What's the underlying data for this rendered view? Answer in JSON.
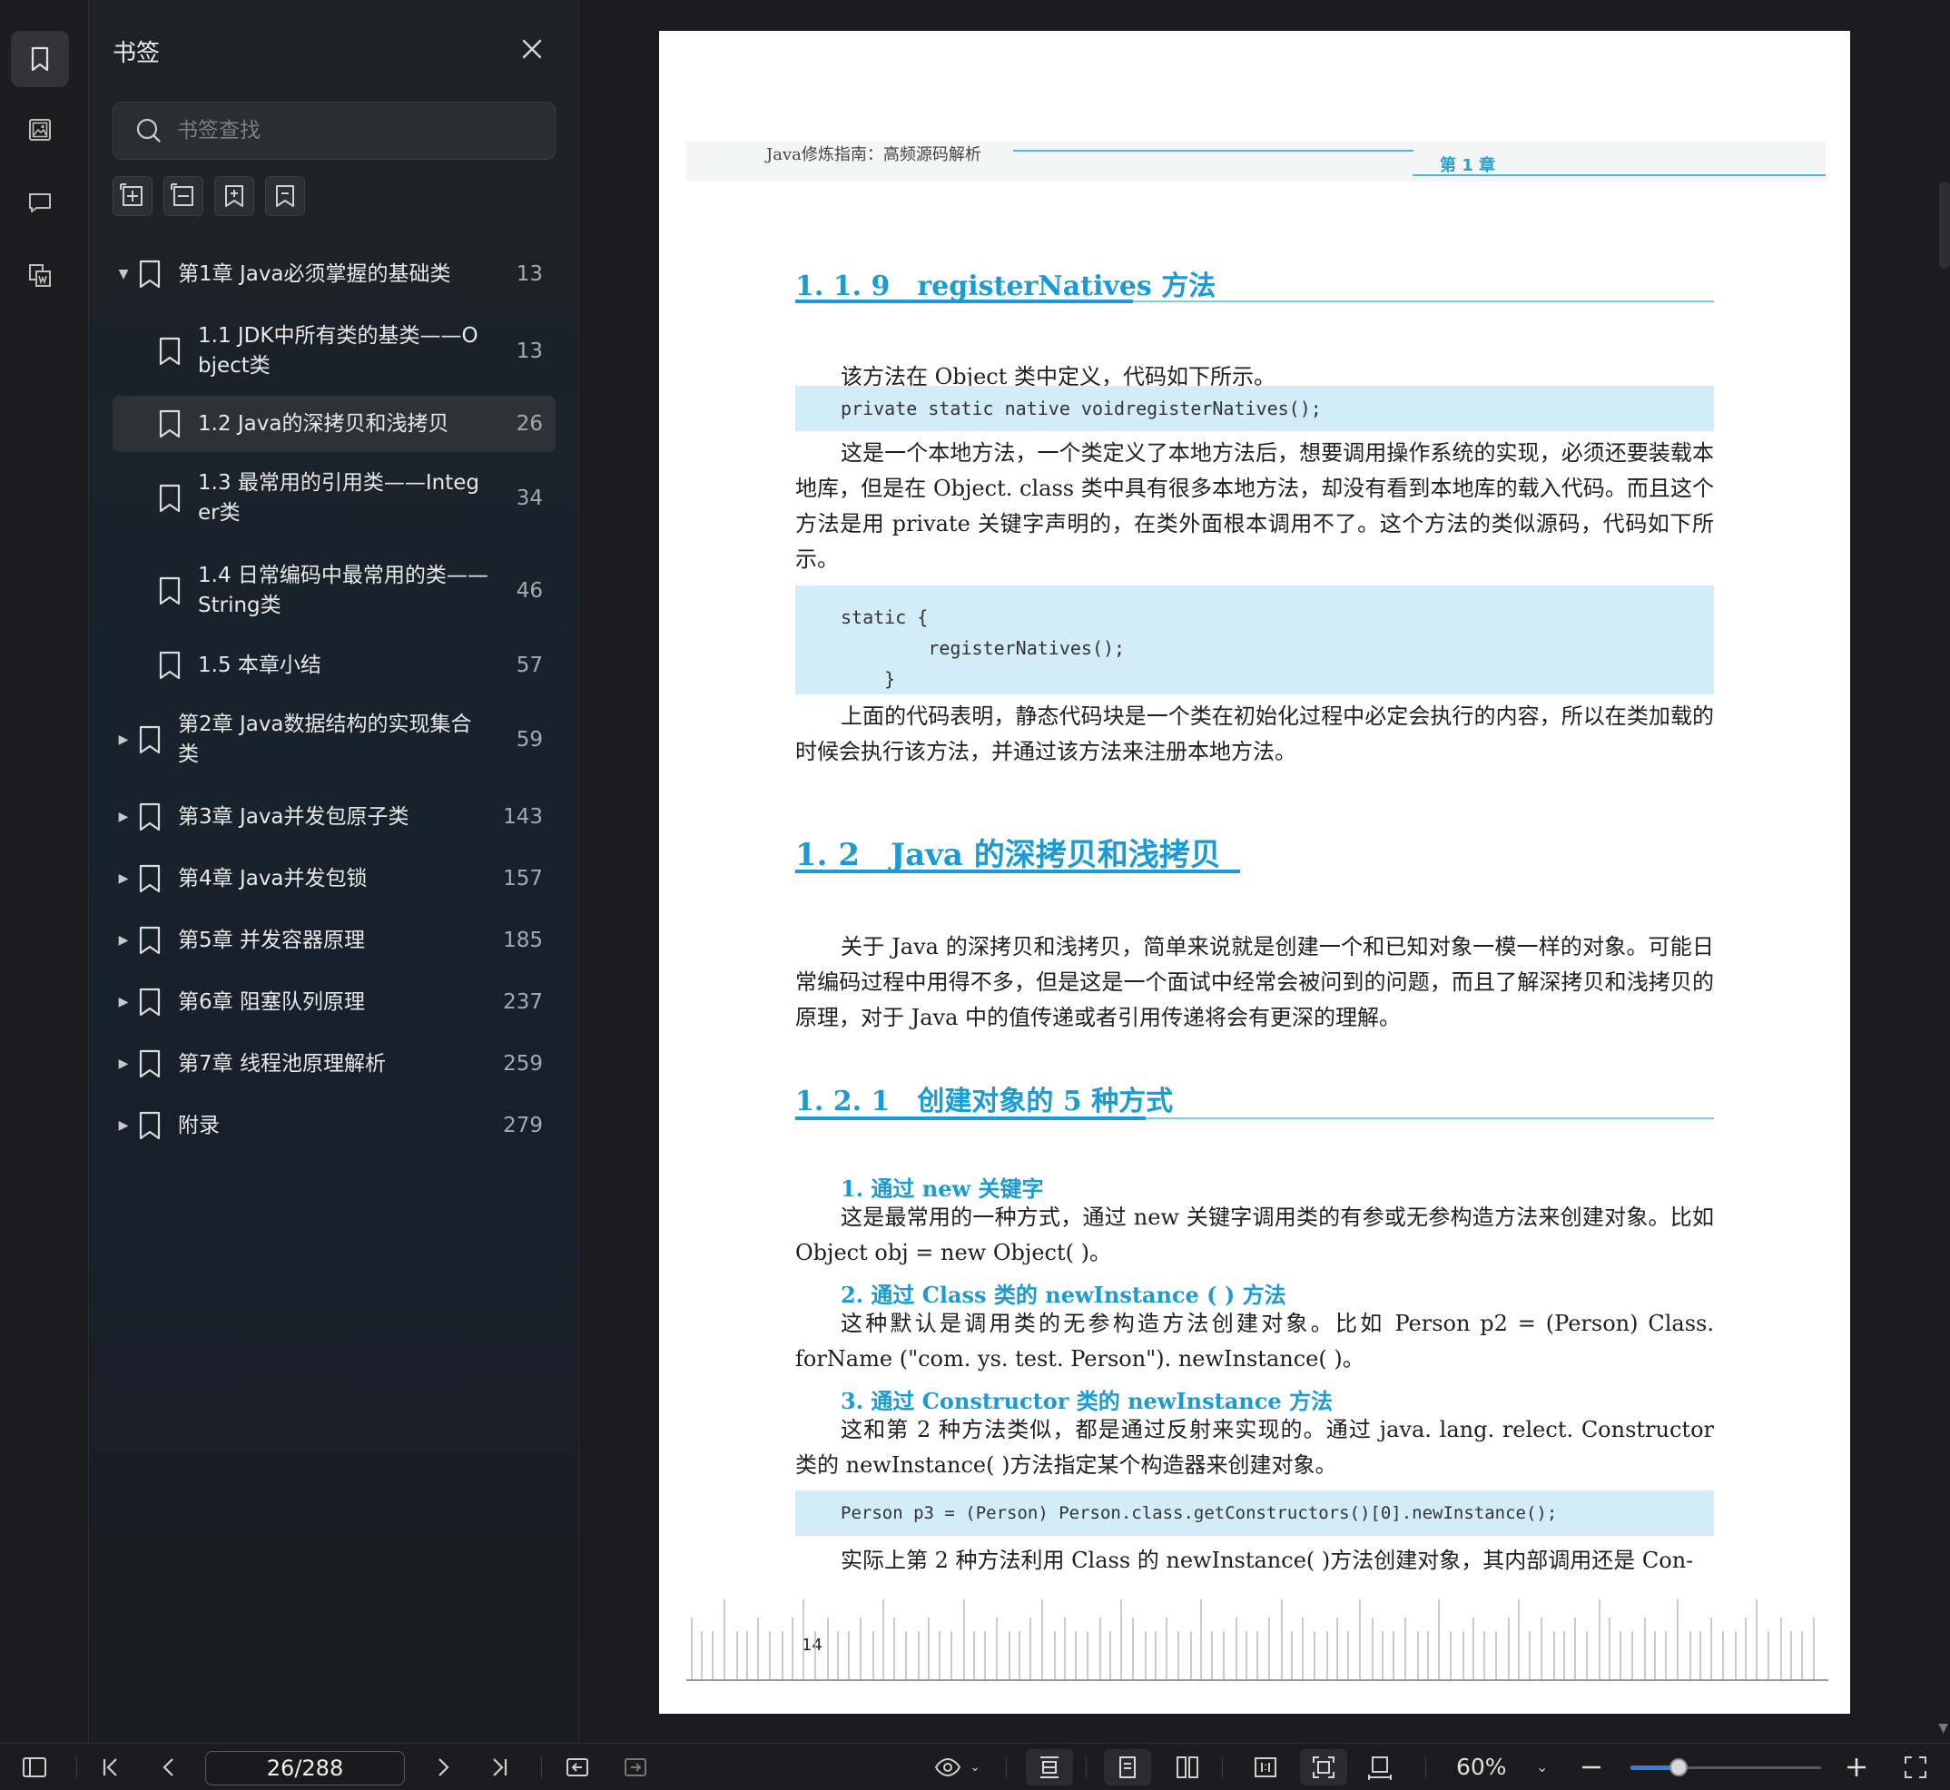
{
  "sidebar": {
    "title": "书签",
    "search_placeholder": "书签查找",
    "bookmarks": [
      {
        "label": "第1章 Java必须掌握的基础类",
        "page": "13",
        "level": 0,
        "expanded": true
      },
      {
        "label": "1.1 JDK中所有类的基类——Object类",
        "page": "13",
        "level": 1
      },
      {
        "label": "1.2 Java的深拷贝和浅拷贝",
        "page": "26",
        "level": 1,
        "selected": true
      },
      {
        "label": "1.3 最常用的引用类——Integer类",
        "page": "34",
        "level": 1
      },
      {
        "label": "1.4 日常编码中最常用的类——String类",
        "page": "46",
        "level": 1
      },
      {
        "label": "1.5 本章小结",
        "page": "57",
        "level": 1
      },
      {
        "label": "第2章 Java数据结构的实现集合类",
        "page": "59",
        "level": 0
      },
      {
        "label": "第3章 Java并发包原子类",
        "page": "143",
        "level": 0
      },
      {
        "label": "第4章 Java并发包锁",
        "page": "157",
        "level": 0
      },
      {
        "label": "第5章 并发容器原理",
        "page": "185",
        "level": 0
      },
      {
        "label": "第6章 阻塞队列原理",
        "page": "237",
        "level": 0
      },
      {
        "label": "第7章 线程池原理解析",
        "page": "259",
        "level": 0
      },
      {
        "label": "附录",
        "page": "279",
        "level": 0
      }
    ]
  },
  "document": {
    "header_book": "Java修炼指南：高频源码解析",
    "header_chapter": "第 1 章",
    "h_119": "1. 1. 9　registerNatives 方法",
    "p1": "该方法在 Object 类中定义，代码如下所示。",
    "code1": "private static native voidregisterNatives();",
    "p2": "这是一个本地方法，一个类定义了本地方法后，想要调用操作系统的实现，必须还要装载本地库，但是在 Object. class 类中具有很多本地方法，却没有看到本地库的载入代码。而且这个方法是用 private 关键字声明的，在类外面根本调用不了。这个方法的类似源码，代码如下所示。",
    "code2": "static {\n        registerNatives();\n    }",
    "p3": "上面的代码表明，静态代码块是一个类在初始化过程中必定会执行的内容，所以在类加载的时候会执行该方法，并通过该方法来注册本地方法。",
    "h_12": "1. 2　Java 的深拷贝和浅拷贝",
    "p4": "关于 Java 的深拷贝和浅拷贝，简单来说就是创建一个和已知对象一模一样的对象。可能日常编码过程中用得不多，但是这是一个面试中经常会被问到的问题，而且了解深拷贝和浅拷贝的原理，对于 Java 中的值传递或者引用传递将会有更深的理解。",
    "h_121": "1. 2. 1　创建对象的 5 种方式",
    "s1": "1. 通过 new 关键字",
    "p5": "这是最常用的一种方式，通过 new 关键字调用类的有参或无参构造方法来创建对象。比如 Object obj = new Object( )。",
    "s2": "2. 通过 Class 类的 newInstance ( ) 方法",
    "p6": "这种默认是调用类的无参构造方法创建对象。比如 Person p2 = (Person) Class. forName (\"com. ys. test. Person\"). newInstance( )。",
    "s3": "3. 通过 Constructor 类的 newInstance 方法",
    "p7": "这和第 2 种方法类似，都是通过反射来实现的。通过 java. lang. relect. Constructor 类的 newInstance( )方法指定某个构造器来创建对象。",
    "code3": "Person p3 = (Person) Person.class.getConstructors()[0].newInstance();",
    "p8": "实际上第 2 种方法利用 Class 的 newInstance( )方法创建对象，其内部调用还是 Con-",
    "page_number": "14"
  },
  "toolbar": {
    "page_input": "26/288",
    "zoom": "60%",
    "zoom_fraction": 0.25
  },
  "colors": {
    "accent": "#1a9bd3",
    "code_bg": "#d2ecf8",
    "slider": "#2f7fe0"
  }
}
